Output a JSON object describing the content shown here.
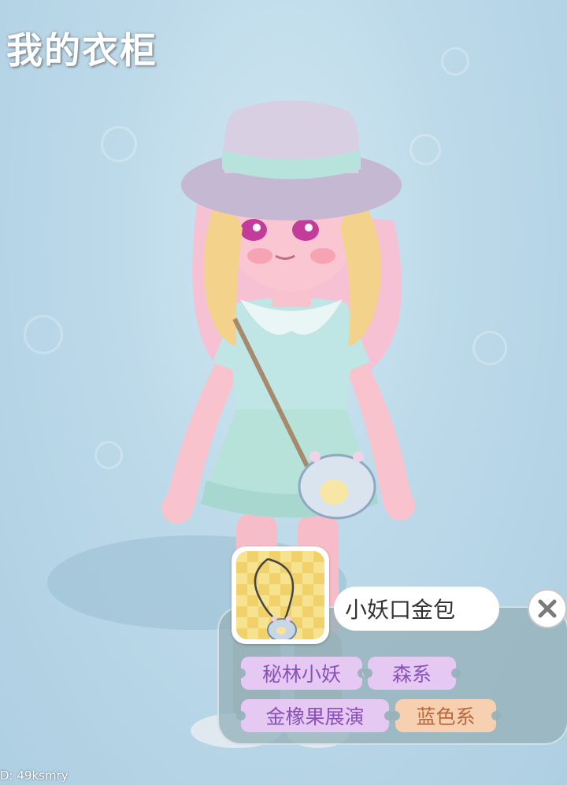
{
  "page": {
    "title": "我的衣柜"
  },
  "item_card": {
    "name": "小妖口金包",
    "tags": [
      {
        "label": "秘林小妖",
        "color": "purple"
      },
      {
        "label": "森系",
        "color": "purple"
      },
      {
        "label": "金橡果展演",
        "color": "purple"
      },
      {
        "label": "蓝色系",
        "color": "peach"
      }
    ]
  },
  "footer": {
    "uid": "D: 49ksmry"
  },
  "colors": {
    "background": "#b9d7e7",
    "tag_purple_bg": "#e6c9f3",
    "tag_purple_text": "#8a52b8",
    "tag_peach_bg": "#f6d0b1",
    "tag_peach_text": "#b8683b"
  }
}
